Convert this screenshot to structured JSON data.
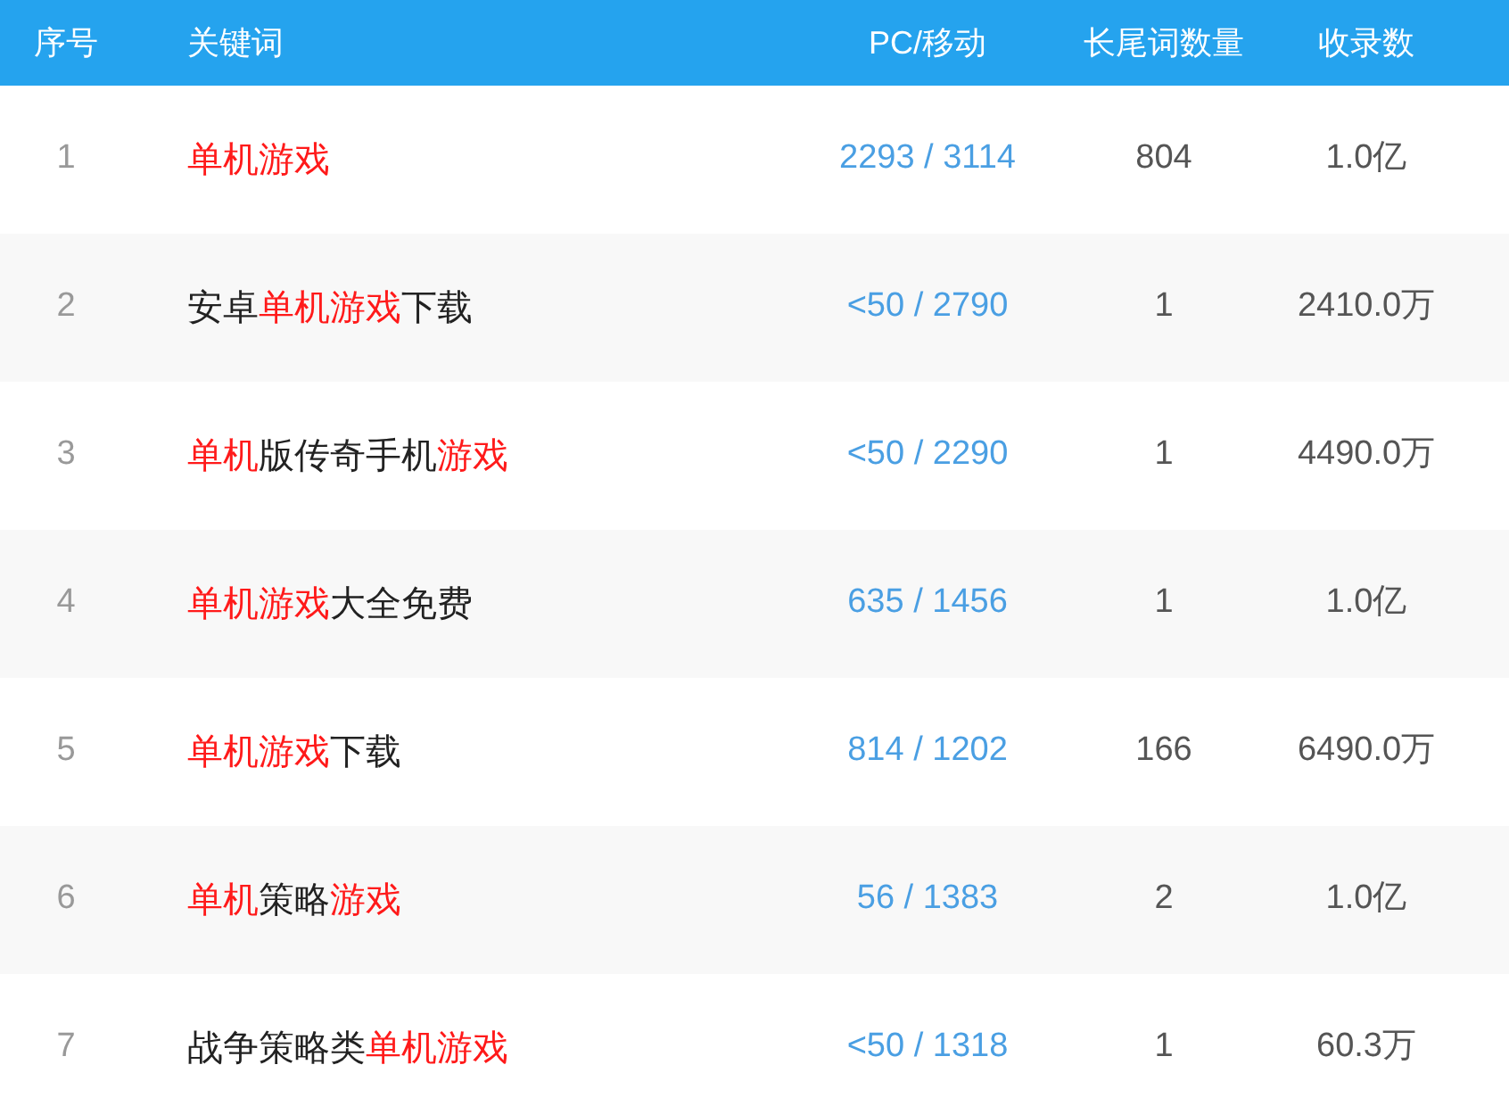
{
  "table": {
    "columns": [
      "序号",
      "关键词",
      "PC/移动",
      "长尾词数量",
      "收录数"
    ],
    "rows": [
      {
        "index": "1",
        "keyword": [
          {
            "text": "单机游戏",
            "highlight": true
          }
        ],
        "pc_mobile": "2293 / 3114",
        "long_tail": "804",
        "indexed": "1.0亿"
      },
      {
        "index": "2",
        "keyword": [
          {
            "text": "安卓",
            "highlight": false
          },
          {
            "text": "单机游戏",
            "highlight": true
          },
          {
            "text": "下载",
            "highlight": false
          }
        ],
        "pc_mobile": "<50 / 2790",
        "long_tail": "1",
        "indexed": "2410.0万"
      },
      {
        "index": "3",
        "keyword": [
          {
            "text": "单机",
            "highlight": true
          },
          {
            "text": "版传奇手机",
            "highlight": false
          },
          {
            "text": "游戏",
            "highlight": true
          }
        ],
        "pc_mobile": "<50 / 2290",
        "long_tail": "1",
        "indexed": "4490.0万"
      },
      {
        "index": "4",
        "keyword": [
          {
            "text": "单机游戏",
            "highlight": true
          },
          {
            "text": "大全免费",
            "highlight": false
          }
        ],
        "pc_mobile": "635 / 1456",
        "long_tail": "1",
        "indexed": "1.0亿"
      },
      {
        "index": "5",
        "keyword": [
          {
            "text": "单机游戏",
            "highlight": true
          },
          {
            "text": "下载",
            "highlight": false
          }
        ],
        "pc_mobile": "814 / 1202",
        "long_tail": "166",
        "indexed": "6490.0万"
      },
      {
        "index": "6",
        "keyword": [
          {
            "text": "单机",
            "highlight": true
          },
          {
            "text": "策略",
            "highlight": false
          },
          {
            "text": "游戏",
            "highlight": true
          }
        ],
        "pc_mobile": "56 / 1383",
        "long_tail": "2",
        "indexed": "1.0亿"
      },
      {
        "index": "7",
        "keyword": [
          {
            "text": "战争策略类",
            "highlight": false
          },
          {
            "text": "单机游戏",
            "highlight": true
          }
        ],
        "pc_mobile": "<50 / 1318",
        "long_tail": "1",
        "indexed": "60.3万"
      }
    ]
  }
}
